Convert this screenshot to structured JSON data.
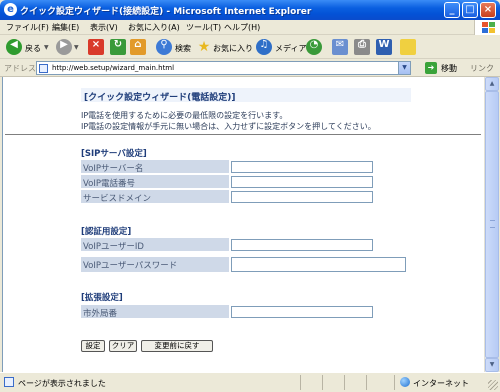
{
  "window": {
    "title": "クイック設定ウィザード(接続設定) - Microsoft Internet Explorer",
    "buttons": {
      "minimize": "_",
      "maximize": "□",
      "close": "×"
    }
  },
  "menu": [
    "ファイル(F)",
    "編集(E)",
    "表示(V)",
    "お気に入り(A)",
    "ツール(T)",
    "ヘルプ(H)"
  ],
  "toolbar": {
    "back_label": "戻る",
    "search_label": "検索",
    "favorites_label": "お気に入り",
    "media_label": "メディア"
  },
  "address": {
    "label": "アドレス(D)",
    "url": "http://web.setup/wizard_main.html",
    "go_label": "移動",
    "links_label": "リンク »"
  },
  "page": {
    "title": "[クイック設定ウィザード(電話設定)]",
    "intro_line1": "IP電話を使用するために必要の最低限の設定を行います。",
    "intro_line2": "IP電話の設定情報が手元に無い場合は、入力せずに設定ボタンを押してください。",
    "sections": {
      "sip": {
        "heading": "[SIPサーバ設定]",
        "server_name_label": "VoIPサーバー名",
        "phone_number_label": "VoIP電話番号",
        "service_domain_label": "サービスドメイン"
      },
      "auth": {
        "heading": "[認証用設定]",
        "user_id_label": "VoIPユーザーID",
        "password_label": "VoIPユーザーパスワード"
      },
      "extended": {
        "heading": "[拡張設定]",
        "area_code_label": "市外局番"
      }
    },
    "buttons": {
      "submit": "設定",
      "clear": "クリア",
      "restore": "変更前に戻す"
    }
  },
  "status": {
    "text": "ページが表示されました",
    "zone": "インターネット"
  },
  "colors": {
    "title_bar": "#0a5fe0",
    "section_heading": "#1f3d7a",
    "form_label_bg": "#cfd9e8"
  }
}
